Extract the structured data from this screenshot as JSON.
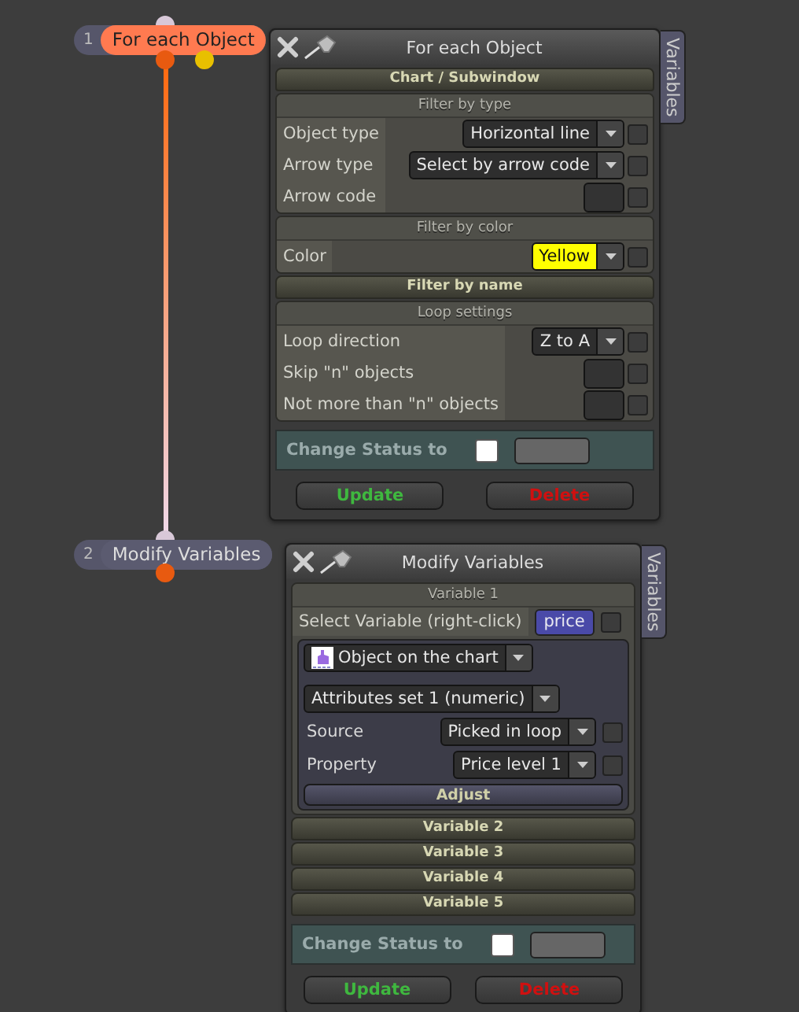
{
  "nodes": [
    {
      "number": "1",
      "label": "For each Object",
      "selected": true
    },
    {
      "number": "2",
      "label": "Modify Variables",
      "selected": false
    }
  ],
  "windows": [
    {
      "title": "For each Object",
      "side_tab": "Variables",
      "sections": [
        {
          "kind": "bar",
          "title": "Chart / Subwindow"
        },
        {
          "kind": "group",
          "title": "Filter by type",
          "rows": [
            {
              "label": "Object type",
              "control": {
                "kind": "dropdown",
                "value": "Horizontal line"
              },
              "checked": false
            },
            {
              "label": "Arrow type",
              "control": {
                "kind": "dropdown",
                "value": "Select by arrow code"
              },
              "checked": false
            },
            {
              "label": "Arrow code",
              "control": {
                "kind": "field"
              },
              "checked": false
            }
          ]
        },
        {
          "kind": "group",
          "title": "Filter by color",
          "rows": [
            {
              "label": "Color",
              "control": {
                "kind": "dropdown",
                "value": "Yellow",
                "color": "#ffff00"
              },
              "checked": false
            }
          ]
        },
        {
          "kind": "bar",
          "title": "Filter by name"
        },
        {
          "kind": "group",
          "title": "Loop settings",
          "rows": [
            {
              "label": "Loop direction",
              "control": {
                "kind": "dropdown",
                "value": "Z to A"
              },
              "checked": false
            },
            {
              "label": "Skip \"n\" objects",
              "control": {
                "kind": "field"
              },
              "checked": false
            },
            {
              "label": "Not more than \"n\" objects",
              "control": {
                "kind": "field"
              },
              "checked": false
            }
          ]
        }
      ],
      "status": {
        "label": "Change Status to",
        "checked": false
      },
      "buttons": [
        {
          "label": "Update",
          "kind": "confirm"
        },
        {
          "label": "Delete",
          "kind": "danger"
        }
      ]
    },
    {
      "title": "Modify Variables",
      "side_tab": "Variables",
      "sections": [
        {
          "kind": "variable",
          "title": "Variable 1",
          "select_label": "Select Variable (right-click)",
          "variable": "price",
          "checked": false,
          "panel": {
            "object": "Object on the chart",
            "attributes": "Attributes set 1 (numeric)",
            "rows": [
              {
                "label": "Source",
                "control": {
                  "kind": "dropdown",
                  "value": "Picked in loop"
                },
                "checked": false
              },
              {
                "label": "Property",
                "control": {
                  "kind": "dropdown",
                  "value": "Price level 1"
                },
                "checked": false
              }
            ],
            "button": "Adjust"
          }
        },
        {
          "kind": "bar",
          "title": "Variable 2"
        },
        {
          "kind": "bar",
          "title": "Variable 3"
        },
        {
          "kind": "bar",
          "title": "Variable 4"
        },
        {
          "kind": "bar",
          "title": "Variable 5"
        }
      ],
      "status": {
        "label": "Change Status to",
        "checked": false
      },
      "buttons": [
        {
          "label": "Update",
          "kind": "confirm"
        },
        {
          "label": "Delete",
          "kind": "danger"
        }
      ]
    }
  ]
}
